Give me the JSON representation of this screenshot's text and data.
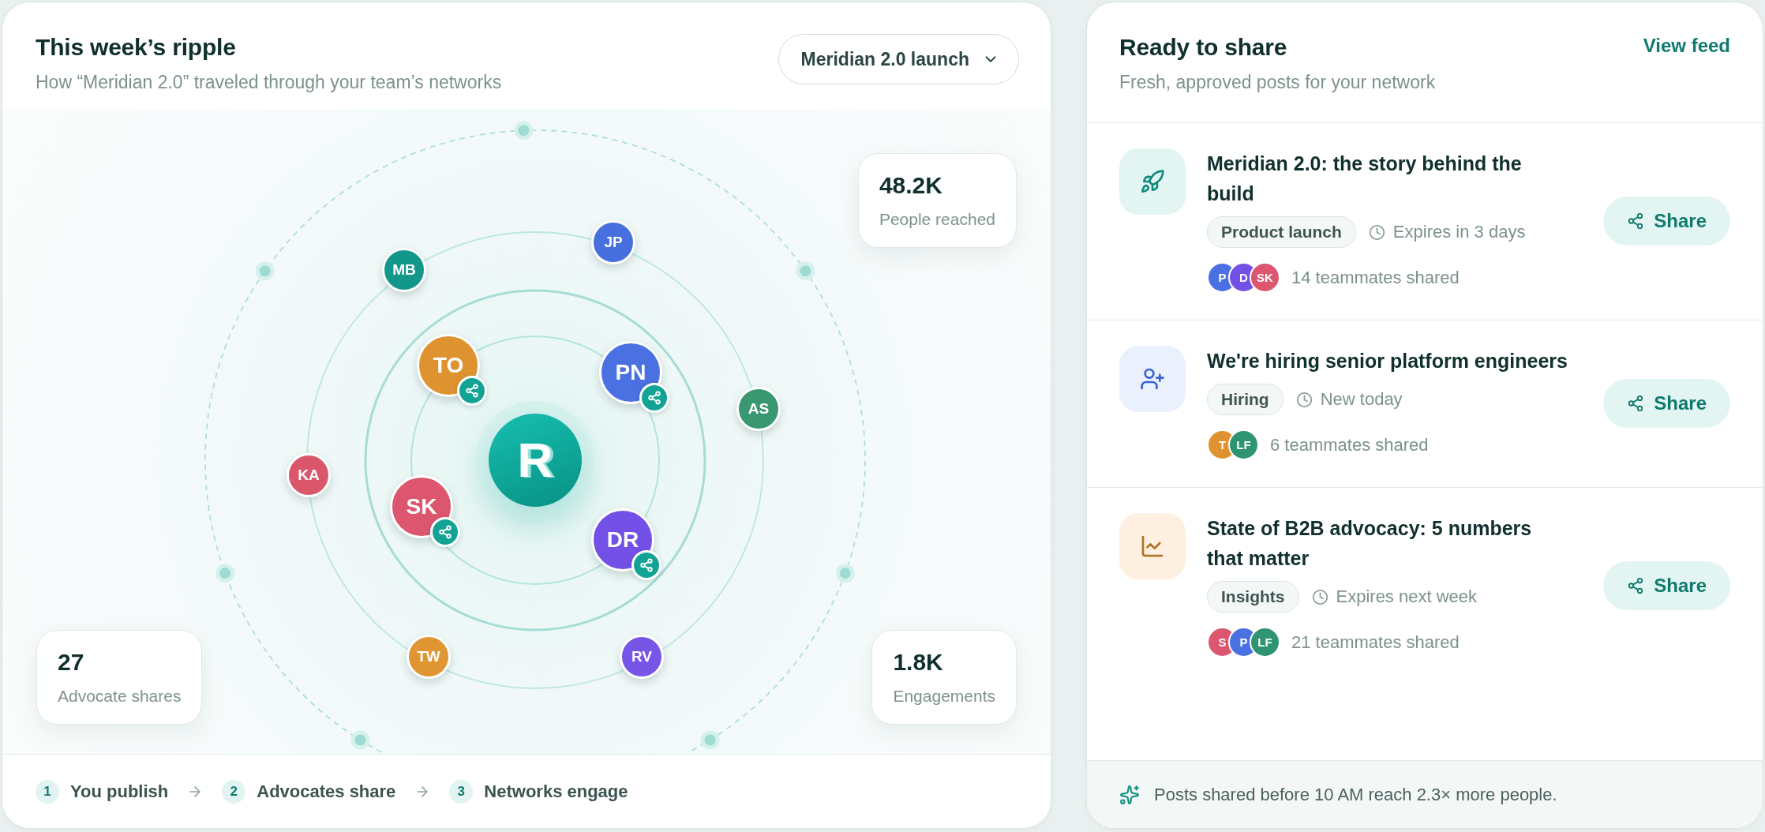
{
  "ripple_card": {
    "title": "This week’s ripple",
    "subtitle": "How “Meridian 2.0” traveled through your team’s networks",
    "campaign_select": {
      "value": "Meridian 2.0 launch"
    },
    "hub": {
      "logo_text": "R"
    },
    "advocates": [
      {
        "initials": "JP",
        "color": "#4770de",
        "shared": false
      },
      {
        "initials": "MB",
        "color": "#12978a",
        "shared": false
      },
      {
        "initials": "TO",
        "color": "#df9330",
        "shared": true
      },
      {
        "initials": "PN",
        "color": "#4a70e2",
        "shared": true
      },
      {
        "initials": "AS",
        "color": "#3b9772",
        "shared": false
      },
      {
        "initials": "KA",
        "color": "#da566b",
        "shared": false
      },
      {
        "initials": "SK",
        "color": "#dc566f",
        "shared": true
      },
      {
        "initials": "DR",
        "color": "#7350e6",
        "shared": true
      },
      {
        "initials": "TW",
        "color": "#de9532",
        "shared": false
      },
      {
        "initials": "RV",
        "color": "#7755e7",
        "shared": false
      }
    ],
    "stats": [
      {
        "value": "48.2K",
        "label": "People reached"
      },
      {
        "value": "27",
        "label": "Advocate shares"
      },
      {
        "value": "1.8K",
        "label": "Engagements"
      }
    ],
    "steps": [
      {
        "number": "1",
        "label": "You publish"
      },
      {
        "number": "2",
        "label": "Advocates share"
      },
      {
        "number": "3",
        "label": "Networks engage"
      }
    ]
  },
  "share_card": {
    "title": "Ready to share",
    "subtitle": "Fresh, approved posts for your network",
    "view_feed_link": "View feed",
    "posts": [
      {
        "kind": "launch",
        "title": "Meridian 2.0: the story behind the build",
        "tag": "Product launch",
        "timing": "Expires in 3 days",
        "sharers": [
          {
            "initials": "P",
            "color": "#4a70e2"
          },
          {
            "initials": "D",
            "color": "#7350e6"
          },
          {
            "initials": "SK",
            "color": "#dc566f"
          }
        ],
        "shared_count": "14 teammates shared",
        "action": "Share"
      },
      {
        "kind": "hiring",
        "title": "We're hiring senior platform engineers",
        "tag": "Hiring",
        "timing": "New today",
        "sharers": [
          {
            "initials": "T",
            "color": "#df9330"
          },
          {
            "initials": "LF",
            "color": "#2f9471"
          }
        ],
        "shared_count": "6 teammates shared",
        "action": "Share"
      },
      {
        "kind": "insights",
        "title": "State of B2B advocacy: 5 numbers that matter",
        "tag": "Insights",
        "timing": "Expires next week",
        "sharers": [
          {
            "initials": "S",
            "color": "#dc566f"
          },
          {
            "initials": "P",
            "color": "#4a70e2"
          },
          {
            "initials": "LF",
            "color": "#2f9471"
          }
        ],
        "shared_count": "21 teammates shared",
        "action": "Share"
      }
    ],
    "tip": "Posts shared before 10 AM reach 2.3× more people."
  }
}
